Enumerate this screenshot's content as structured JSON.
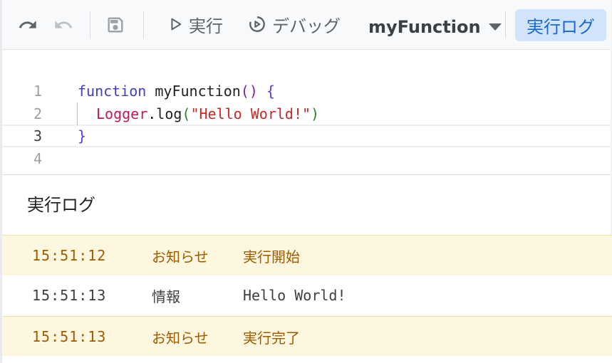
{
  "toolbar": {
    "undo_icon": "undo-icon",
    "redo_icon": "redo-icon",
    "save_icon": "save-icon",
    "run_label": "実行",
    "debug_label": "デバッグ",
    "function_select": "myFunction",
    "exec_log_label": "実行ログ"
  },
  "editor": {
    "line_numbers": [
      "1",
      "2",
      "3",
      "4"
    ],
    "active_line": "3",
    "code": {
      "line1": {
        "kw": "function",
        "name": " myFunction",
        "parens": "()",
        "brace": " {"
      },
      "line2": {
        "obj": "Logger",
        "dot": ".",
        "method": "log",
        "open": "(",
        "str": "\"Hello World!\"",
        "close": ")"
      },
      "line3": {
        "brace": "}"
      },
      "line4": ""
    }
  },
  "log": {
    "title": "実行ログ",
    "rows": [
      {
        "time": "15:51:12",
        "level": "お知らせ",
        "message": "実行開始"
      },
      {
        "time": "15:51:13",
        "level": "情報",
        "message": "Hello World!"
      },
      {
        "time": "15:51:13",
        "level": "お知らせ",
        "message": "実行完了"
      }
    ]
  },
  "colors": {
    "accent": "#1967d2",
    "exec_log_bg": "#d2e3fc",
    "notice_bg": "#fef7e0",
    "notice_text": "#a05a00"
  }
}
